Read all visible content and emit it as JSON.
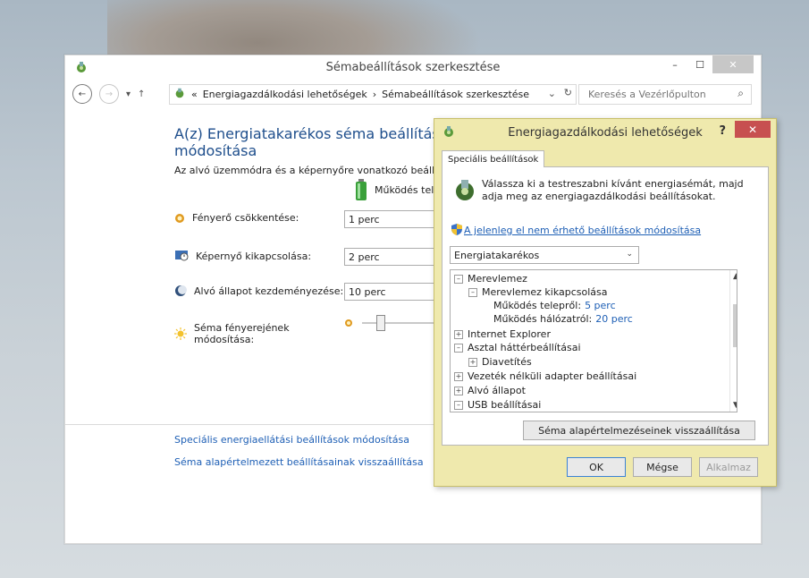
{
  "main_window": {
    "title": "Sémabeállítások szerkesztése",
    "caption": {
      "minimize": "–",
      "maximize": "☐",
      "close": "✕"
    },
    "breadcrumb": {
      "prefix": "«",
      "items": [
        "Energiagazdálkodási lehetőségek",
        "Sémabeállítások szerkesztése"
      ],
      "separator": "›"
    },
    "search_placeholder": "Keresés a Vezérlőpulton",
    "heading": "A(z) Energiatakarékos séma beállításainak módosítása",
    "subheading": "Az alvó üzemmódra és a képernyőre vonatkozó beállítások módosítása",
    "column_header": "Működés telepről",
    "rows": [
      {
        "label": "Fényerő csökkentése:",
        "value": "1 perc",
        "icon": "sun-dim-icon"
      },
      {
        "label": "Képernyő kikapcsolása:",
        "value": "2 perc",
        "icon": "monitor-icon"
      },
      {
        "label": "Alvó állapot kezdeményezése:",
        "value": "10 perc",
        "icon": "moon-icon"
      },
      {
        "label": "Séma fényerejének módosítása:",
        "icon": "sun-bright-icon",
        "brightness_level": 0.25
      }
    ],
    "links": [
      "Speciális energiaellátási beállítások módosítása",
      "Séma alapértelmezett beállításainak visszaállítása"
    ]
  },
  "dialog": {
    "title": "Energiagazdálkodási lehetőségek",
    "help": "?",
    "close": "✕",
    "tab": "Speciális beállítások",
    "intro": "Válassza ki a testreszabni kívánt energiasémát, majd adja meg az energiagazdálkodási beállításokat.",
    "unavailable_link": "A jelenleg el nem érhető beállítások módosítása",
    "plan_selected": "Energiatakarékos",
    "tree": [
      {
        "text": "Merevlemez",
        "box": "⊟",
        "level": 0
      },
      {
        "text": "Merevlemez kikapcsolása",
        "box": "⊟",
        "level": 1
      },
      {
        "text": "Működés telepről:",
        "value": "5 perc",
        "level": 2
      },
      {
        "text": "Működés hálózatról:",
        "value": "20 perc",
        "level": 2
      },
      {
        "text": "Internet Explorer",
        "box": "⊞",
        "level": 0
      },
      {
        "text": "Asztal háttérbeállításai",
        "box": "⊟",
        "level": 0
      },
      {
        "text": "Diavetítés",
        "box": "⊞",
        "level": 1
      },
      {
        "text": "Vezeték nélküli adapter beállításai",
        "box": "⊞",
        "level": 0
      },
      {
        "text": "Alvó állapot",
        "box": "⊞",
        "level": 0
      },
      {
        "text": "USB beállításai",
        "box": "⊟",
        "level": 0
      }
    ],
    "restore_button": "Séma alapértelmezéseinek visszaállítása",
    "buttons": {
      "ok": "OK",
      "cancel": "Mégse",
      "apply": "Alkalmaz"
    }
  },
  "colors": {
    "link": "#1e5fb5",
    "heading": "#1e4e8c",
    "dialog_bg": "#efe9ad",
    "dialog_close": "#c75050"
  }
}
